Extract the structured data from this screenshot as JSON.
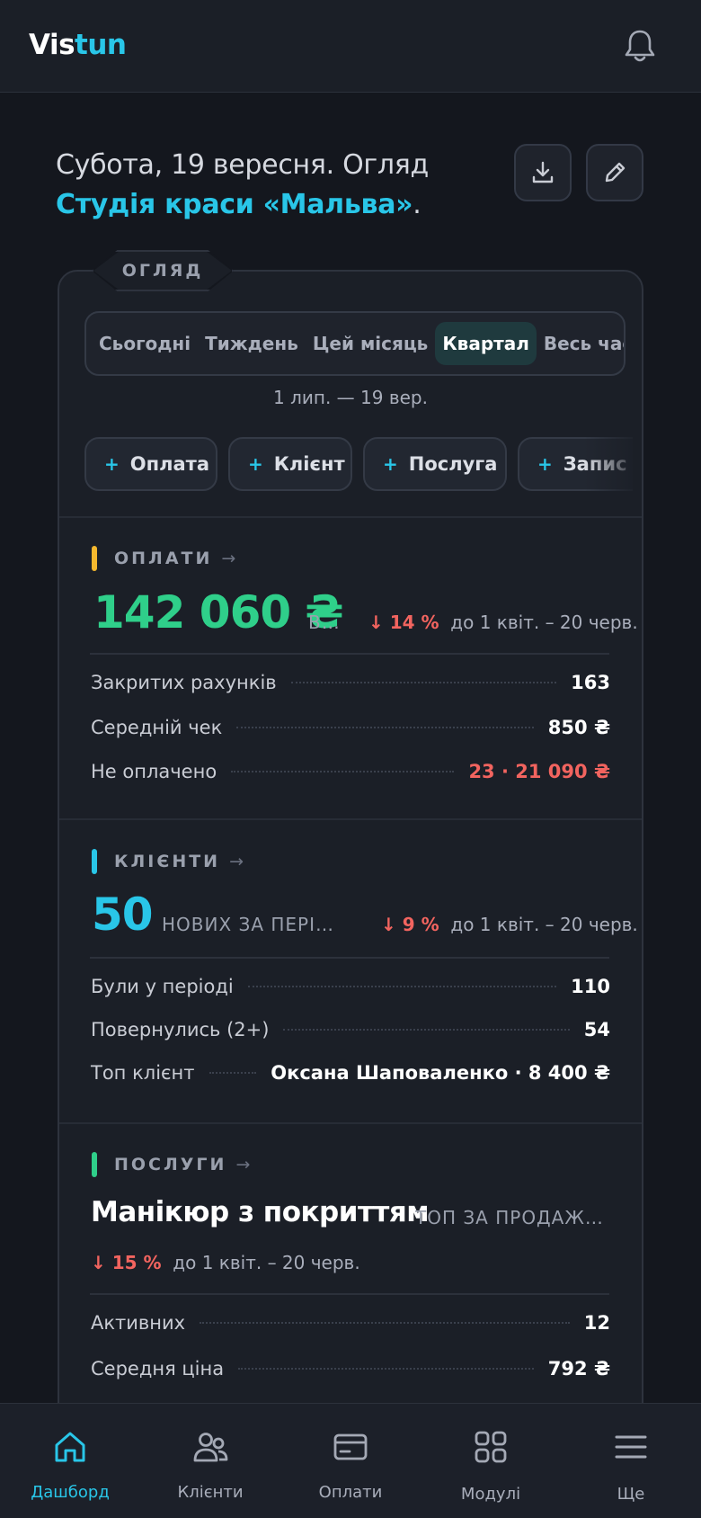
{
  "header": {
    "logo_part1": "Vis",
    "logo_part2": "tun",
    "bell_icon": "bell-icon"
  },
  "intro": {
    "text": "Субота, 19 вересня. Огляд ",
    "studio": "Студія краси «Мальва»",
    "tail": "."
  },
  "actions": {
    "download_icon": "download-icon",
    "edit_icon": "pencil-icon"
  },
  "overview": {
    "tag": "ОГЛЯД",
    "periods": [
      "Сьогодні",
      "Тиждень",
      "Цей місяць",
      "Квартал",
      "Весь час"
    ],
    "active_period": "Квартал",
    "range": "1 лип. — 19 вер.",
    "quick_add": [
      "Оплата",
      "Клієнт",
      "Послуга",
      "Запис"
    ]
  },
  "payments": {
    "title": "ОПЛАТИ",
    "arrow": "→",
    "amount": "142 060 ₴",
    "sub": "ВИ…",
    "delta": "↓ 14 %",
    "compare": "до 1 квіт. – 20 черв.",
    "rows": [
      {
        "label": "Закритих рахунків",
        "value": "163"
      },
      {
        "label": "Середній чек",
        "value": "850 ₴"
      },
      {
        "label": "Не оплачено",
        "value": "23 · 21 090 ₴"
      }
    ]
  },
  "clients": {
    "title": "КЛІЄНТИ",
    "arrow": "→",
    "amount": "50",
    "sub": "НОВИХ ЗА ПЕРІОД",
    "delta": "↓ 9 %",
    "compare": "до 1 квіт. – 20 черв.",
    "rows": [
      {
        "label": "Були у періоді",
        "value": "110"
      },
      {
        "label": "Повернулись (2+)",
        "value": "54"
      },
      {
        "label": "Топ клієнт",
        "value": "Оксана Шаповаленко · 8 400 ₴"
      }
    ]
  },
  "services": {
    "title": "ПОСЛУГИ",
    "arrow": "→",
    "name": "Манікюр з покриттям",
    "sub": "ТОП ЗА ПРОДАЖАМ…",
    "delta": "↓ 15 %",
    "compare": "до 1 квіт. – 20 черв.",
    "rows": [
      {
        "label": "Активних",
        "value": "12"
      },
      {
        "label": "Середня ціна",
        "value": "792 ₴"
      }
    ]
  },
  "nav": [
    {
      "label": "Дашборд",
      "icon": "home-icon",
      "active": true
    },
    {
      "label": "Клієнти",
      "icon": "users-icon"
    },
    {
      "label": "Оплати",
      "icon": "card-icon"
    },
    {
      "label": "Модулі",
      "icon": "grid-icon"
    },
    {
      "label": "Ще",
      "icon": "menu-icon"
    }
  ],
  "colors": {
    "accent": "#29c6e8",
    "green": "#2fcf8a",
    "red": "#f2645f",
    "yellow": "#f5b82e"
  }
}
